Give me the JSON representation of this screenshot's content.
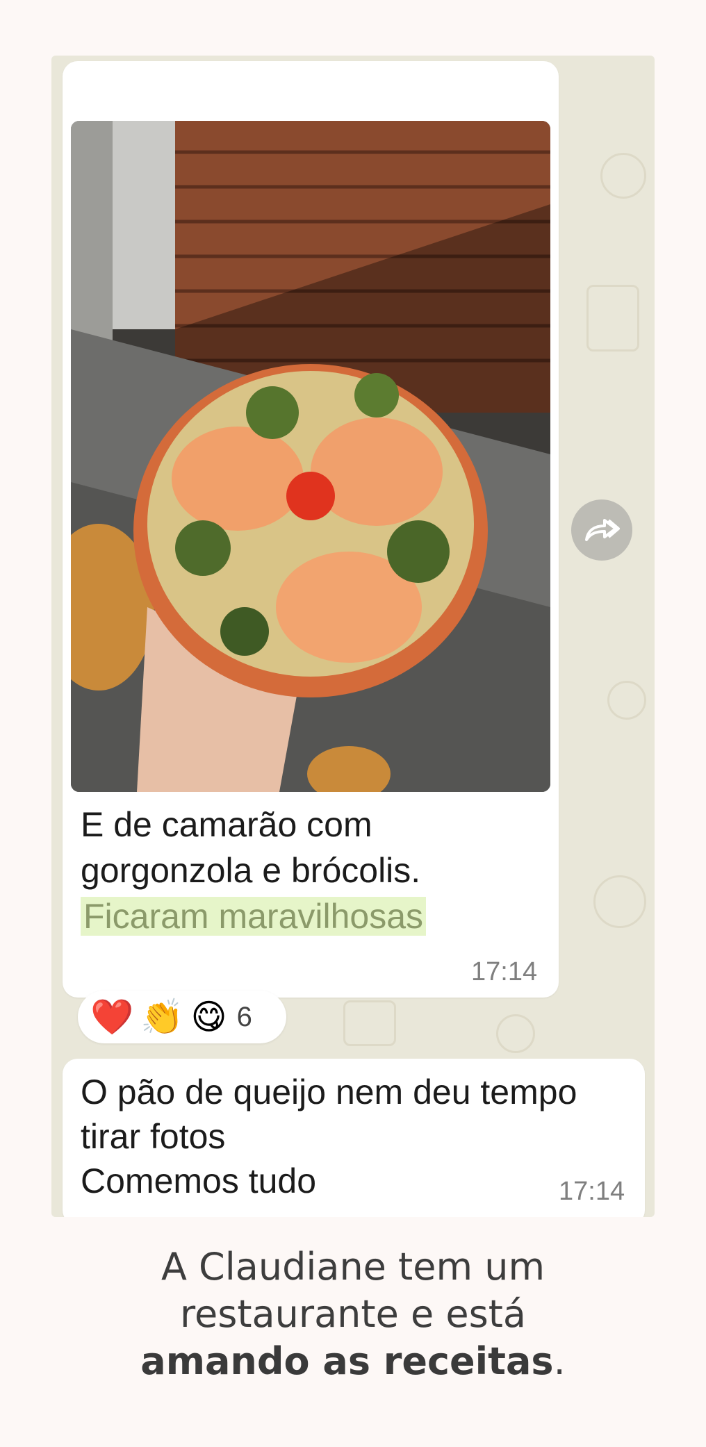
{
  "colors": {
    "page_background": "#fdf8f6",
    "chat_wallpaper": "#e9e7d9",
    "bubble": "#ffffff",
    "highlight": "#e6f5c9"
  },
  "message_photo": {
    "image": "photo of a small pizza topped with shrimp, broccoli, gorgonzola and a cherry tomato, held by a hand in front of a brick wall",
    "caption_line1": "E de camarão com",
    "caption_line2": "gorgonzola e brócolis.",
    "caption_highlight": "Ficaram maravilhosas",
    "time": "17:14"
  },
  "reactions": {
    "emojis": [
      "❤️",
      "👏",
      "😋"
    ],
    "count": "6"
  },
  "message_text": {
    "line1": "O pão de queijo nem deu tempo",
    "line2": "tirar fotos",
    "line3": "Comemos tudo",
    "time": "17:14"
  },
  "forward_button": {
    "icon": "forward-icon"
  },
  "footer": {
    "line1": "A Claudiane tem um",
    "line2": "restaurante e está",
    "line3_bold": "amando as receitas",
    "line3_tail": "."
  }
}
